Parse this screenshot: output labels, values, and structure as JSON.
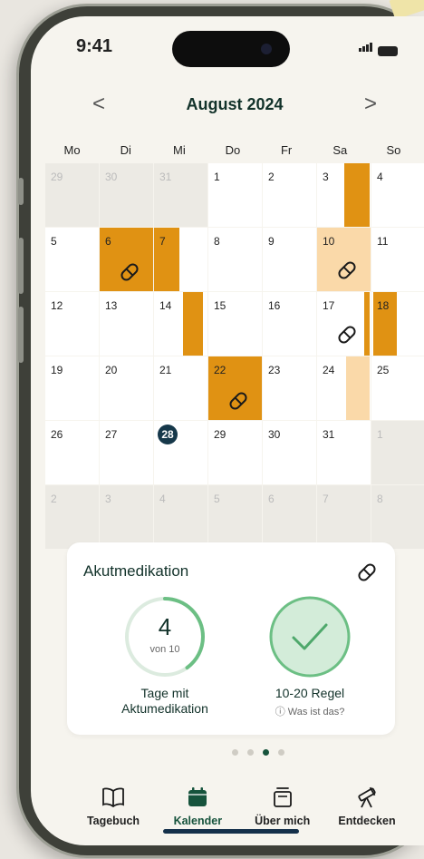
{
  "status": {
    "time": "9:41"
  },
  "calendar": {
    "month_title": "August 2024",
    "prev_label": "<",
    "next_label": ">",
    "weekdays": [
      "Mo",
      "Di",
      "Mi",
      "Do",
      "Fr",
      "Sa",
      "So"
    ],
    "today": "28",
    "weeks": [
      [
        "29",
        "30",
        "31",
        "1",
        "2",
        "3",
        "4"
      ],
      [
        "5",
        "6",
        "7",
        "8",
        "9",
        "10",
        "11"
      ],
      [
        "12",
        "13",
        "14",
        "15",
        "16",
        "17",
        "18"
      ],
      [
        "19",
        "20",
        "21",
        "22",
        "23",
        "24",
        "25"
      ],
      [
        "26",
        "27",
        "28",
        "29",
        "30",
        "31",
        "1"
      ],
      [
        "2",
        "3",
        "4",
        "5",
        "6",
        "7",
        "8"
      ]
    ],
    "medication_days": [
      "6",
      "10",
      "17",
      "22"
    ],
    "colors": {
      "headache_strong": "#e09213",
      "headache_light": "#fad9a9",
      "today": "#16384a"
    }
  },
  "card": {
    "title": "Akutmedikation",
    "count": "4",
    "count_sub": "von 10",
    "count_fraction": 0.4,
    "days_label_line1": "Tage mit",
    "days_label_line2": "Aktumedikation",
    "rule_label": "10-20 Regel",
    "rule_info": "Was ist das?",
    "rule_info_icon": "info-icon"
  },
  "pager": {
    "total": 4,
    "active": 2
  },
  "tabbar": {
    "tabs": [
      {
        "label": "Tagebuch",
        "icon": "book-icon"
      },
      {
        "label": "Kalender",
        "icon": "calendar-icon"
      },
      {
        "label": "Über mich",
        "icon": "profile-box-icon"
      },
      {
        "label": "Entdecken",
        "icon": "telescope-icon"
      }
    ],
    "active_index": 1,
    "accent": "#16533c"
  }
}
